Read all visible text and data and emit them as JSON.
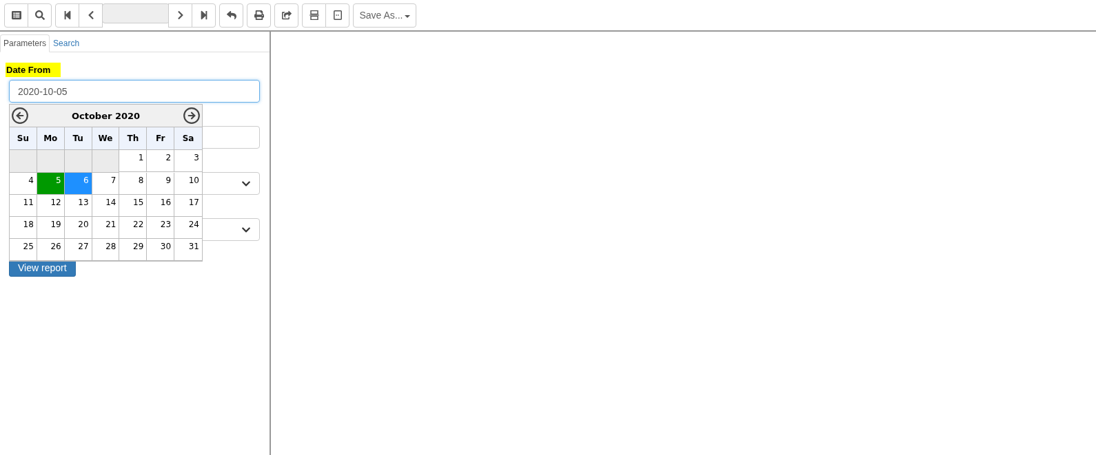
{
  "toolbar": {
    "groups": [
      [
        {
          "kind": "button"
        },
        {
          "kind": "button"
        }
      ],
      [
        {
          "kind": "button"
        },
        {
          "kind": "button"
        },
        {
          "kind": "page"
        },
        {
          "kind": "button"
        },
        {
          "kind": "button"
        }
      ],
      [
        {
          "kind": "button"
        }
      ],
      [
        {
          "kind": "button"
        }
      ],
      [
        {
          "kind": "button"
        }
      ],
      [
        {
          "kind": "button"
        },
        {
          "kind": "button"
        }
      ],
      [
        {
          "kind": "menu",
          "label": "Save As..."
        }
      ]
    ]
  },
  "tabs": [
    {
      "label": "Parameters",
      "selected": true
    },
    {
      "label": "Search",
      "selected": false
    }
  ],
  "parameters": {
    "label": "Date From",
    "value": "2020-10-05",
    "fields": [
      {
        "kind": "text"
      },
      {
        "kind": "select"
      },
      {
        "kind": "select"
      }
    ],
    "button": "View report"
  },
  "calendar": {
    "title": "October 2020",
    "weekdays": [
      "Su",
      "Mo",
      "Tu",
      "We",
      "Th",
      "Fr",
      "Sa"
    ],
    "weeks": [
      [
        {
          "kind": "empty"
        },
        {
          "kind": "empty"
        },
        {
          "kind": "empty"
        },
        {
          "kind": "empty"
        },
        {
          "kind": "day",
          "day": "1",
          "selected": false,
          "today": false
        },
        {
          "kind": "day",
          "day": "2",
          "selected": false,
          "today": false
        },
        {
          "kind": "day",
          "day": "3",
          "selected": false,
          "today": false
        }
      ],
      [
        {
          "kind": "day",
          "day": "4",
          "selected": false,
          "today": false
        },
        {
          "kind": "day",
          "day": "5",
          "selected": true,
          "today": false
        },
        {
          "kind": "day",
          "day": "6",
          "selected": false,
          "today": true
        },
        {
          "kind": "day",
          "day": "7",
          "selected": false,
          "today": false
        },
        {
          "kind": "day",
          "day": "8",
          "selected": false,
          "today": false
        },
        {
          "kind": "day",
          "day": "9",
          "selected": false,
          "today": false
        },
        {
          "kind": "day",
          "day": "10",
          "selected": false,
          "today": false
        }
      ],
      [
        {
          "kind": "day",
          "day": "11",
          "selected": false,
          "today": false
        },
        {
          "kind": "day",
          "day": "12",
          "selected": false,
          "today": false
        },
        {
          "kind": "day",
          "day": "13",
          "selected": false,
          "today": false
        },
        {
          "kind": "day",
          "day": "14",
          "selected": false,
          "today": false
        },
        {
          "kind": "day",
          "day": "15",
          "selected": false,
          "today": false
        },
        {
          "kind": "day",
          "day": "16",
          "selected": false,
          "today": false
        },
        {
          "kind": "day",
          "day": "17",
          "selected": false,
          "today": false
        }
      ],
      [
        {
          "kind": "day",
          "day": "18",
          "selected": false,
          "today": false
        },
        {
          "kind": "day",
          "day": "19",
          "selected": false,
          "today": false
        },
        {
          "kind": "day",
          "day": "20",
          "selected": false,
          "today": false
        },
        {
          "kind": "day",
          "day": "21",
          "selected": false,
          "today": false
        },
        {
          "kind": "day",
          "day": "22",
          "selected": false,
          "today": false
        },
        {
          "kind": "day",
          "day": "23",
          "selected": false,
          "today": false
        },
        {
          "kind": "day",
          "day": "24",
          "selected": false,
          "today": false
        }
      ],
      [
        {
          "kind": "day",
          "day": "25",
          "selected": false,
          "today": false
        },
        {
          "kind": "day",
          "day": "26",
          "selected": false,
          "today": false
        },
        {
          "kind": "day",
          "day": "27",
          "selected": false,
          "today": false
        },
        {
          "kind": "day",
          "day": "28",
          "selected": false,
          "today": false
        },
        {
          "kind": "day",
          "day": "29",
          "selected": false,
          "today": false
        },
        {
          "kind": "day",
          "day": "30",
          "selected": false,
          "today": false
        },
        {
          "kind": "day",
          "day": "31",
          "selected": false,
          "today": false
        }
      ]
    ]
  }
}
